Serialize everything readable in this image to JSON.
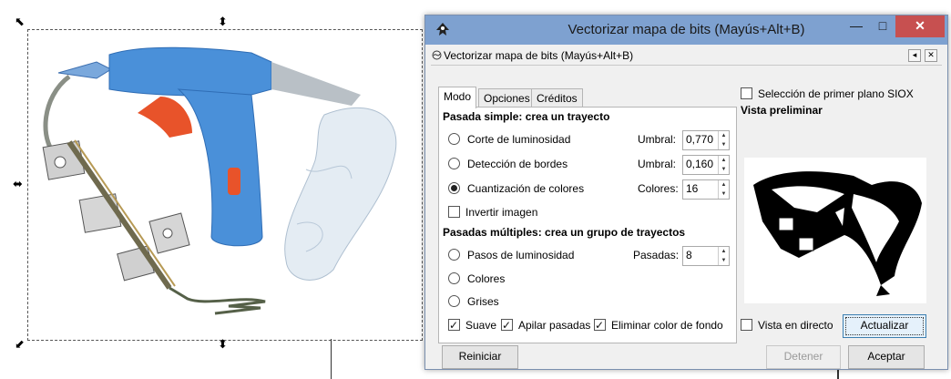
{
  "dialog": {
    "window_title": "Vectorizar mapa de bits (Mayús+Alt+B)",
    "dock_title": "Vectorizar mapa de bits (Mayús+Alt+B)",
    "close_glyph": "✕",
    "minimize_glyph": "—",
    "maximize_glyph": "□"
  },
  "tabs": [
    "Modo",
    "Opciones",
    "Créditos"
  ],
  "single_pass": {
    "heading": "Pasada simple: crea un trayecto",
    "options": [
      {
        "label": "Corte de luminosidad",
        "param_label": "Umbral:",
        "value": "0,770",
        "selected": false
      },
      {
        "label": "Detección de bordes",
        "param_label": "Umbral:",
        "value": "0,160",
        "selected": false
      },
      {
        "label": "Cuantización de colores",
        "param_label": "Colores:",
        "value": "16",
        "selected": true
      }
    ],
    "invert_label": "Invertir imagen",
    "invert_checked": false
  },
  "multi_pass": {
    "heading": "Pasadas múltiples: crea un grupo de trayectos",
    "options": [
      {
        "label": "Pasos de luminosidad",
        "selected": false
      },
      {
        "label": "Colores",
        "selected": false
      },
      {
        "label": "Grises",
        "selected": false
      }
    ],
    "passes_label": "Pasadas:",
    "passes_value": "8",
    "checkboxes": [
      {
        "label": "Suave",
        "checked": true
      },
      {
        "label": "Apilar pasadas",
        "checked": true
      },
      {
        "label": "Eliminar color de fondo",
        "checked": true
      }
    ]
  },
  "right": {
    "siox_label": "Selección de primer plano SIOX",
    "siox_checked": false,
    "preview_heading": "Vista preliminar",
    "live_label": "Vista en directo",
    "live_checked": false,
    "update_button": "Actualizar"
  },
  "buttons": {
    "reset": "Reiniciar",
    "stop": "Detener",
    "accept": "Aceptar"
  },
  "canvas": {
    "handle_glyphs": {
      "diag_tl": "⬉",
      "vert": "⬍",
      "horiz": "⬌",
      "diag_bl": "⬋"
    }
  },
  "colors": {
    "titlebar": "#7ea1d0",
    "close": "#c75050",
    "glue_gun_body": "#4a90d9",
    "glue_gun_trigger": "#e8532a"
  }
}
